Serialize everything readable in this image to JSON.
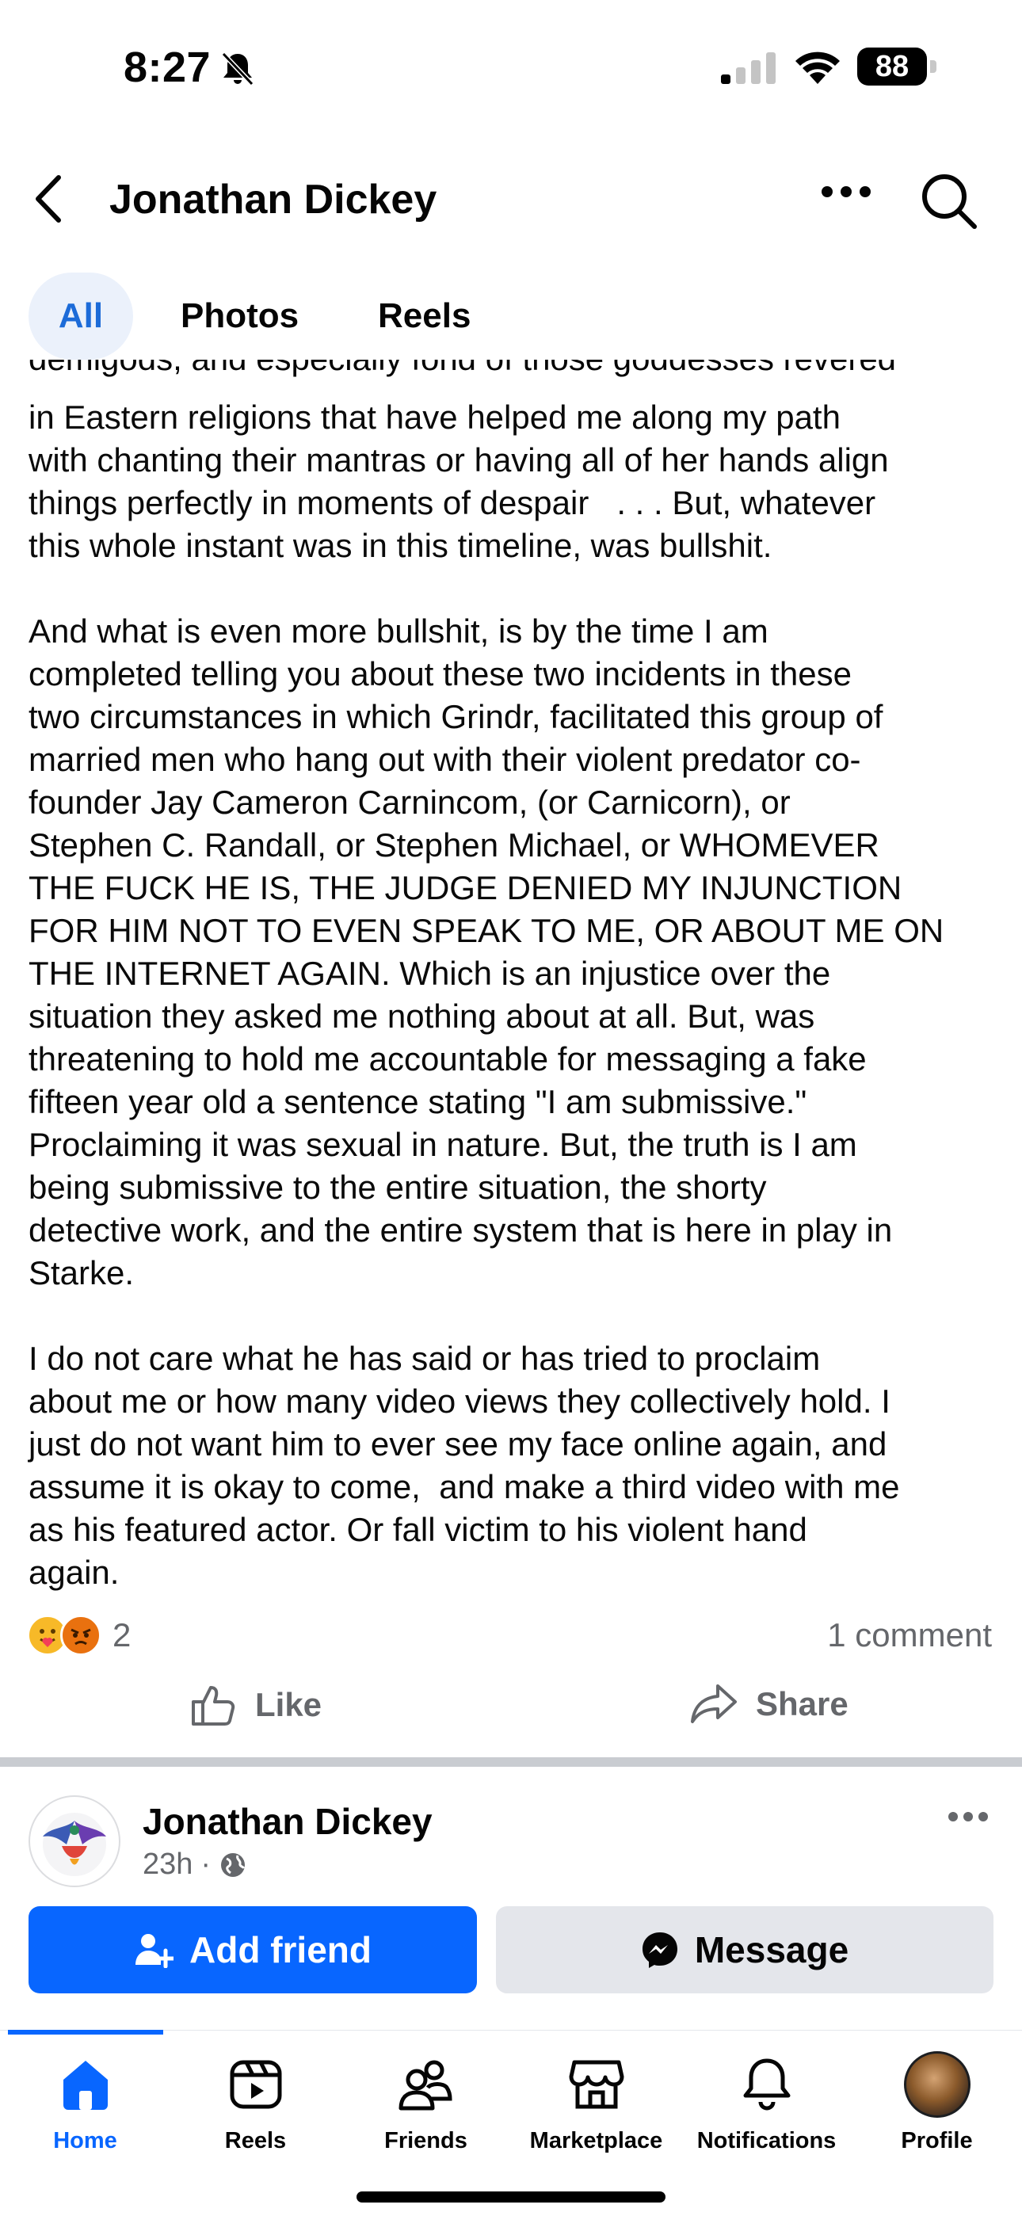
{
  "status_bar": {
    "time": "8:27",
    "battery": "88"
  },
  "header": {
    "title": "Jonathan Dickey"
  },
  "tabs": [
    {
      "label": "All",
      "active": true
    },
    {
      "label": "Photos",
      "active": false
    },
    {
      "label": "Reels",
      "active": false
    }
  ],
  "post": {
    "cut_line": "demigods, and especially fond of those goddesses revered",
    "paragraphs": [
      "in Eastern religions that have helped me along my path\nwith chanting their mantras or having all of her hands align\nthings perfectly in moments of despair   . . . But, whatever\nthis whole instant was in this timeline, was bullshit.",
      "And what is even more bullshit, is by the time I am\ncompleted telling you about these two incidents in these\ntwo circumstances in which Grindr, facilitated this group of\nmarried men who hang out with their violent predator co-\nfounder Jay Cameron Carnincom, (or Carnicorn), or\nStephen C. Randall, or Stephen Michael, or WHOMEVER\nTHE FUCK HE IS, THE JUDGE DENIED MY INJUNCTION\nFOR HIM NOT TO EVEN SPEAK TO ME, OR ABOUT ME ON\nTHE INTERNET AGAIN. Which is an injustice over the\nsituation they asked me nothing about at all. But, was\nthreatening to hold me accountable for messaging a fake\nfifteen year old a sentence stating \"I am submissive.\"\nProclaiming it was sexual in nature. But, the truth is I am\nbeing submissive to the entire situation, the shorty\ndetective work, and the entire system that is here in play in\nStarke.",
      "I do not care what he has said or has tried to proclaim\nabout me or how many video views they collectively hold. I\njust do not want him to ever see my face online again, and\nassume it is okay to come,  and make a third video with me\nas his featured actor. Or fall victim to his violent hand\nagain."
    ],
    "reaction_count": "2",
    "comment_count": "1 comment",
    "like_label": "Like",
    "share_label": "Share"
  },
  "next_post": {
    "author": "Jonathan Dickey",
    "time": "23h",
    "add_friend_label": "Add friend",
    "message_label": "Message"
  },
  "bottom_nav": {
    "items": [
      {
        "label": "Home",
        "icon": "home-icon",
        "active": true
      },
      {
        "label": "Reels",
        "icon": "reels-icon",
        "active": false
      },
      {
        "label": "Friends",
        "icon": "friends-icon",
        "active": false
      },
      {
        "label": "Marketplace",
        "icon": "marketplace-icon",
        "active": false
      },
      {
        "label": "Notifications",
        "icon": "bell-icon",
        "active": false
      },
      {
        "label": "Profile",
        "icon": "avatar",
        "active": false
      }
    ]
  },
  "colors": {
    "accent": "#0866ff",
    "tab_active_bg": "#ebf1fb",
    "secondary_text": "#65676b",
    "message_button_bg": "#e4e6eb"
  }
}
